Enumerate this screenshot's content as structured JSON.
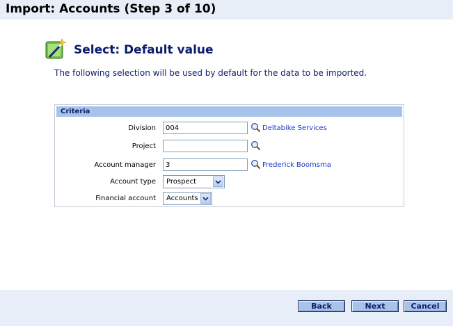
{
  "header": {
    "title": "Import: Accounts (Step 3 of 10)"
  },
  "section": {
    "title": "Select: Default value",
    "icon": "wizard-wand-icon",
    "intro": "The following selection will be used by default for the data to be imported."
  },
  "criteria": {
    "header": "Criteria",
    "division": {
      "label": "Division",
      "value": "004",
      "link": "Deltabike Services"
    },
    "project": {
      "label": "Project",
      "value": ""
    },
    "account_manager": {
      "label": "Account manager",
      "value": "3",
      "link": "Frederick Boomsma"
    },
    "account_type": {
      "label": "Account type",
      "selected": "Prospect"
    },
    "financial_account": {
      "label": "Financial account",
      "selected": "Accounts"
    }
  },
  "footer": {
    "back": "Back",
    "next": "Next",
    "cancel": "Cancel"
  },
  "colors": {
    "header_bg": "#e8eef7",
    "accent": "#a8c3e8",
    "title_text": "#0b1d6b",
    "link": "#1a3ac8"
  }
}
